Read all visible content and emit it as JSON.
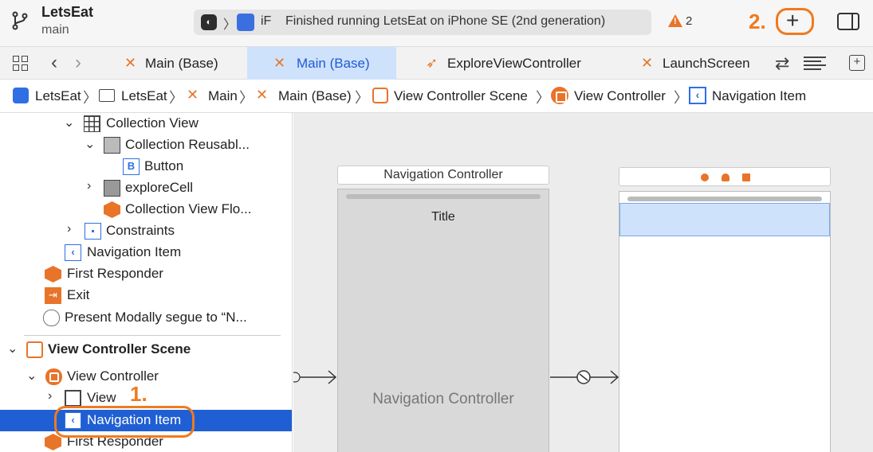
{
  "titlebar": {
    "project_name": "LetsEat",
    "branch": "main",
    "status": {
      "destination": "iF",
      "message": "Finished running LetsEat on iPhone SE (2nd generation)"
    },
    "warnings_count": "2",
    "annotation_2": "2.",
    "add_button_glyph": "+"
  },
  "tabs": [
    {
      "label": "Main (Base)",
      "icon": "storyboard-icon",
      "active": false
    },
    {
      "label": "Main (Base)",
      "icon": "storyboard-icon",
      "active": true
    },
    {
      "label": "ExploreViewController",
      "icon": "swift-icon",
      "active": false
    },
    {
      "label": "LaunchScreen",
      "icon": "storyboard-icon",
      "active": false
    }
  ],
  "breadcrumb": [
    {
      "label": "LetsEat",
      "icon": "app-icon"
    },
    {
      "label": "LetsEat",
      "icon": "folder-icon"
    },
    {
      "label": "Main",
      "icon": "storyboard-icon"
    },
    {
      "label": "Main (Base)",
      "icon": "storyboard-icon"
    },
    {
      "label": "View Controller Scene",
      "icon": "scene-icon"
    },
    {
      "label": "View Controller",
      "icon": "view-controller-icon"
    },
    {
      "label": "Navigation Item",
      "icon": "navigation-item-icon"
    }
  ],
  "outline": {
    "rows": [
      {
        "label": "Collection View",
        "icon": "collection-view-icon",
        "disclosure": "expanded"
      },
      {
        "label": "Collection Reusabl...",
        "icon": "reusable-view-icon",
        "disclosure": "expanded"
      },
      {
        "label": "Button",
        "icon": "button-icon",
        "disclosure": "none"
      },
      {
        "label": "exploreCell",
        "icon": "cell-icon",
        "disclosure": "collapsed"
      },
      {
        "label": "Collection View Flo...",
        "icon": "flow-layout-icon",
        "disclosure": "none"
      },
      {
        "label": "Constraints",
        "icon": "constraints-icon",
        "disclosure": "collapsed"
      },
      {
        "label": "Navigation Item",
        "icon": "navigation-item-icon",
        "disclosure": "none"
      },
      {
        "label": "First Responder",
        "icon": "first-responder-icon",
        "disclosure": "none"
      },
      {
        "label": "Exit",
        "icon": "exit-icon",
        "disclosure": "none"
      },
      {
        "label": "Present Modally segue to “N...",
        "icon": "segue-icon",
        "disclosure": "none"
      },
      {
        "label": "View Controller Scene",
        "icon": "scene-icon",
        "disclosure": "expanded"
      },
      {
        "label": "View Controller",
        "icon": "view-controller-icon",
        "disclosure": "expanded"
      },
      {
        "label": "View",
        "icon": "view-icon",
        "disclosure": "collapsed"
      },
      {
        "label": "Navigation Item",
        "icon": "navigation-item-icon",
        "disclosure": "none",
        "selected": true
      },
      {
        "label": "First Responder",
        "icon": "first-responder-icon",
        "disclosure": "none"
      }
    ],
    "annotation_1": "1."
  },
  "canvas": {
    "nav_controller_header": "Navigation Controller",
    "nav_bar_title": "Title",
    "nav_controller_label": "Navigation Controller"
  },
  "colors": {
    "accent_orange": "#f07a1e",
    "selection_blue": "#1f5fd3",
    "xcode_orange": "#e8742a"
  }
}
